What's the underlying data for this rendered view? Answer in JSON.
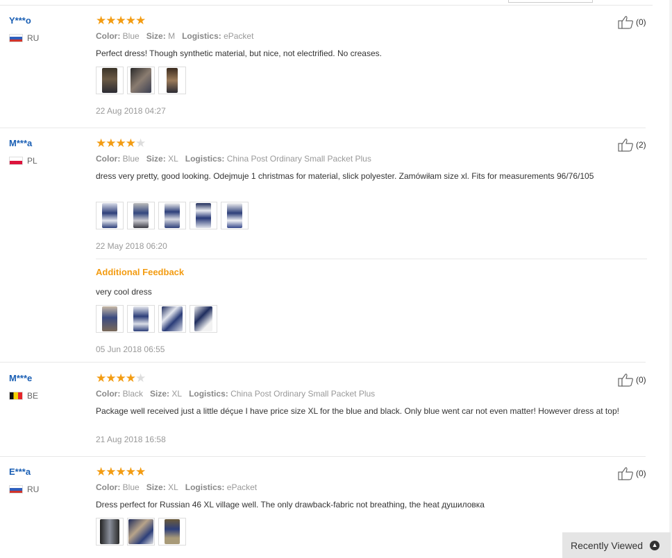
{
  "reviews": [
    {
      "user": "Y***o",
      "country": "RU",
      "flag": "flag-ru",
      "stars": 5,
      "color_label": "Color:",
      "color": "Blue",
      "size_label": "Size:",
      "size": "M",
      "logistics_label": "Logistics:",
      "logistics": "ePacket",
      "text": "Perfect dress! Though synthetic material, but nice, not electrified. No creases.",
      "photo_count": 3,
      "date": "22 Aug 2018 04:27",
      "helpful": "(0)"
    },
    {
      "user": "M***a",
      "country": "PL",
      "flag": "flag-pl",
      "stars": 4,
      "color_label": "Color:",
      "color": "Blue",
      "size_label": "Size:",
      "size": "XL",
      "logistics_label": "Logistics:",
      "logistics": "China Post Ordinary Small Packet Plus",
      "text": "dress very pretty, good looking. Odejmuje 1 christmas for material, slick polyester. Zamówiłam size xl. Fits for measurements 96/76/105",
      "photo_count": 5,
      "date": "22 May 2018 06:20",
      "helpful": "(2)",
      "additional": {
        "title": "Additional Feedback",
        "text": "very cool dress",
        "photo_count": 4,
        "date": "05 Jun 2018 06:55"
      }
    },
    {
      "user": "M***e",
      "country": "BE",
      "flag": "flag-be",
      "stars": 4,
      "color_label": "Color:",
      "color": "Black",
      "size_label": "Size:",
      "size": "XL",
      "logistics_label": "Logistics:",
      "logistics": "China Post Ordinary Small Packet Plus",
      "text": "Package well received just a little déçue I have price size XL for the blue and black. Only blue went car not even matter! However dress at top!",
      "photo_count": 0,
      "date": "21 Aug 2018 16:58",
      "helpful": "(0)"
    },
    {
      "user": "E***a",
      "country": "RU",
      "flag": "flag-ru",
      "stars": 5,
      "color_label": "Color:",
      "color": "Blue",
      "size_label": "Size:",
      "size": "XL",
      "logistics_label": "Logistics:",
      "logistics": "ePacket",
      "text": "Dress perfect for Russian 46 XL village well. The only drawback-fabric not breathing, the heat душиловка",
      "photo_count": 3,
      "date": "",
      "helpful": "(0)"
    }
  ],
  "recently_viewed": {
    "label": "Recently Viewed",
    "icon": "chevron-up-icon"
  },
  "colors": {
    "star": "#f39c12",
    "star_off": "#dddddd",
    "user_link": "#1a5fb4",
    "additional_feedback": "#f39c12"
  }
}
